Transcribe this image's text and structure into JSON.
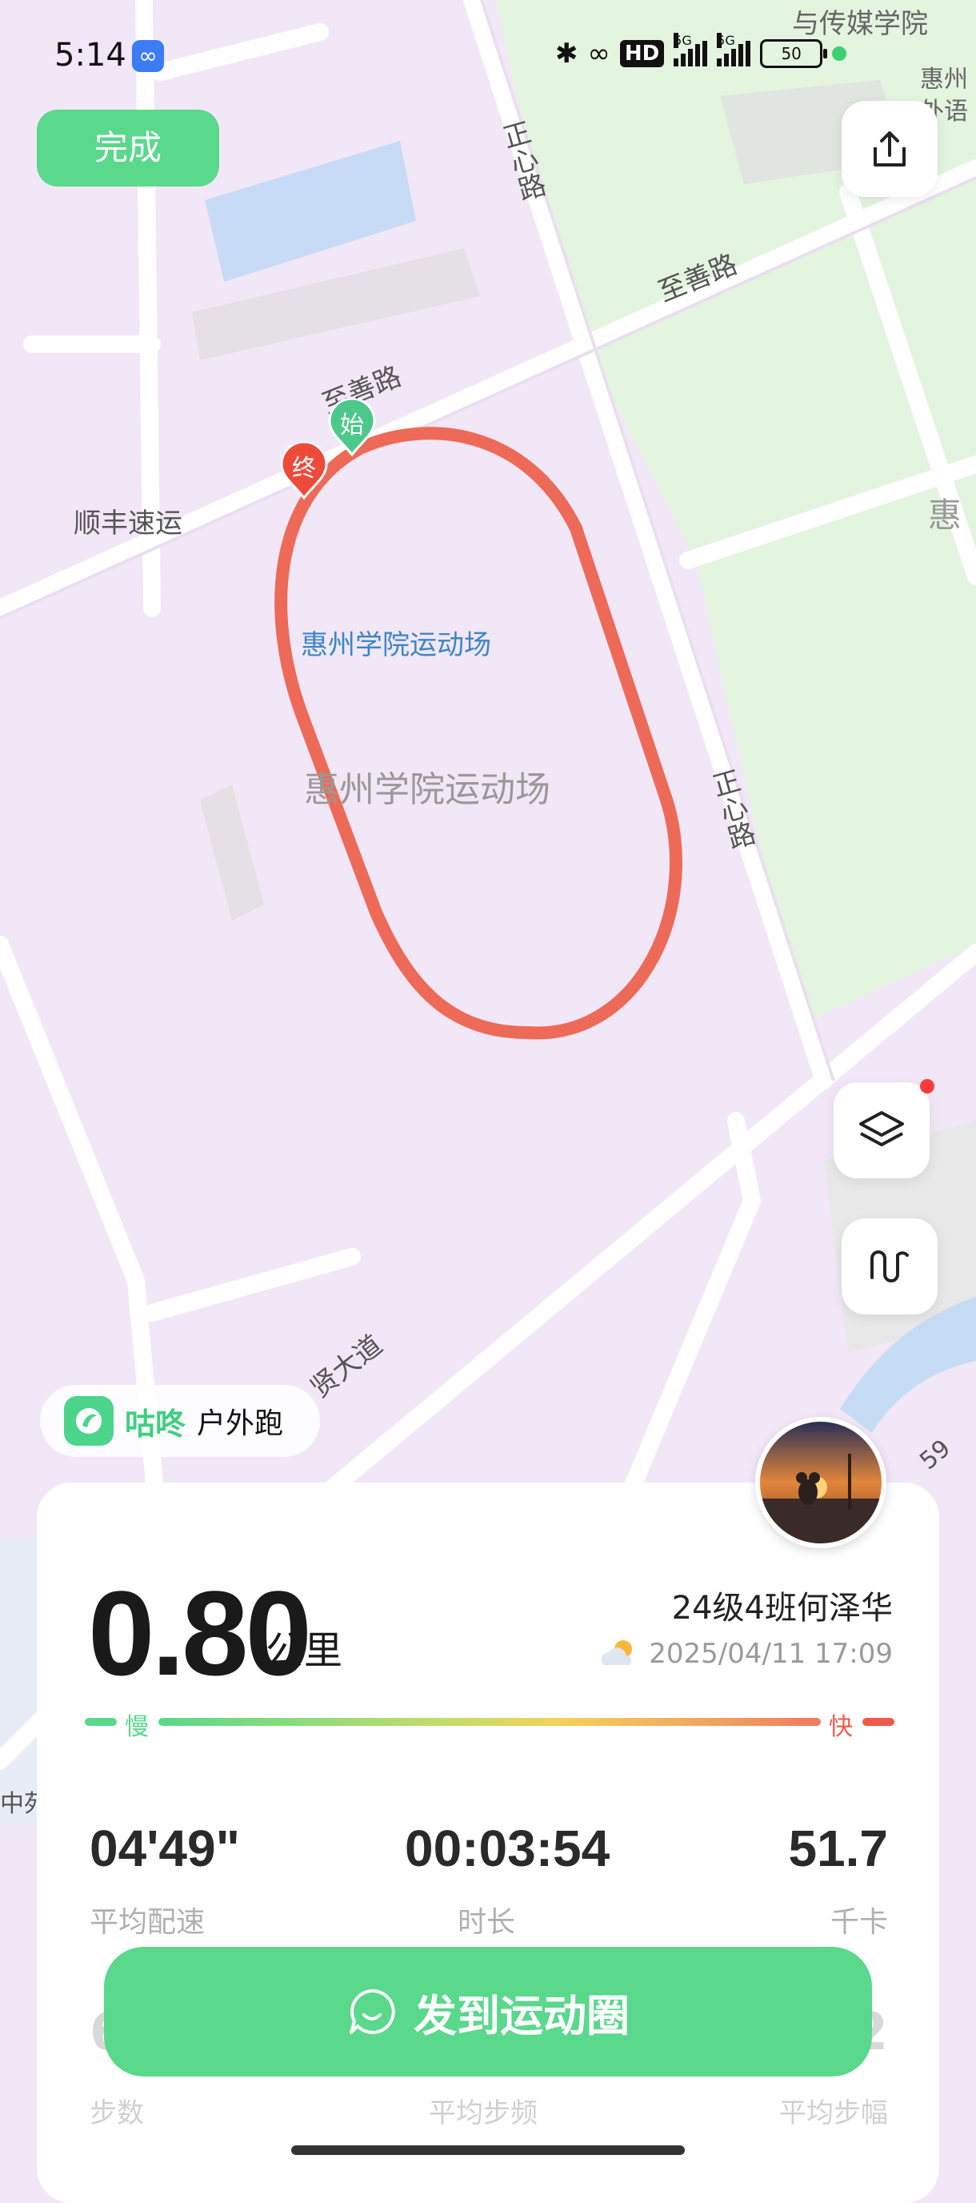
{
  "status": {
    "time": "5:14",
    "hd_label": "HD",
    "net1": "5G",
    "net2": "5G",
    "battery": "50"
  },
  "done_label": "完成",
  "map": {
    "labels": {
      "zhishan_road_top": "至善路",
      "zhishan_road_left": "至善路",
      "zhengxin_road_top": "正心路",
      "zhengxin_road_right": "正心路",
      "shunfeng": "顺丰速运",
      "stadium_blue": "惠州学院运动场",
      "stadium_gray": "惠州学院运动场",
      "hui_right": "惠",
      "media_school": "与传媒学院",
      "foreign_lang": "惠州外语",
      "xian_avenue": "贤大道",
      "zhong": "中苑",
      "num_59": "59"
    },
    "marker_start": "始",
    "marker_end": "终"
  },
  "brand": {
    "name": "咕咚",
    "sub": "户外跑"
  },
  "card": {
    "distance": "0.80",
    "distance_unit": "公里",
    "user_name": "24级4班何泽华",
    "date_time": "2025/04/11 17:09",
    "pace_slow": "慢",
    "pace_fast": "快",
    "stats": [
      {
        "value": "04'49\"",
        "label": "平均配速"
      },
      {
        "value": "00:03:54",
        "label": "时长"
      },
      {
        "value": "51.7",
        "label": "千卡"
      }
    ],
    "stats2": [
      {
        "value": "6",
        "label": "步数"
      },
      {
        "value": "",
        "label": "平均步频"
      },
      {
        "value": "2",
        "label": "平均步幅"
      }
    ]
  },
  "post_label": "发到运动圈",
  "colors": {
    "accent": "#5ad88c",
    "route": "#ee6a58",
    "map_bg": "#f2e7f6",
    "park": "#e4f4e0"
  }
}
